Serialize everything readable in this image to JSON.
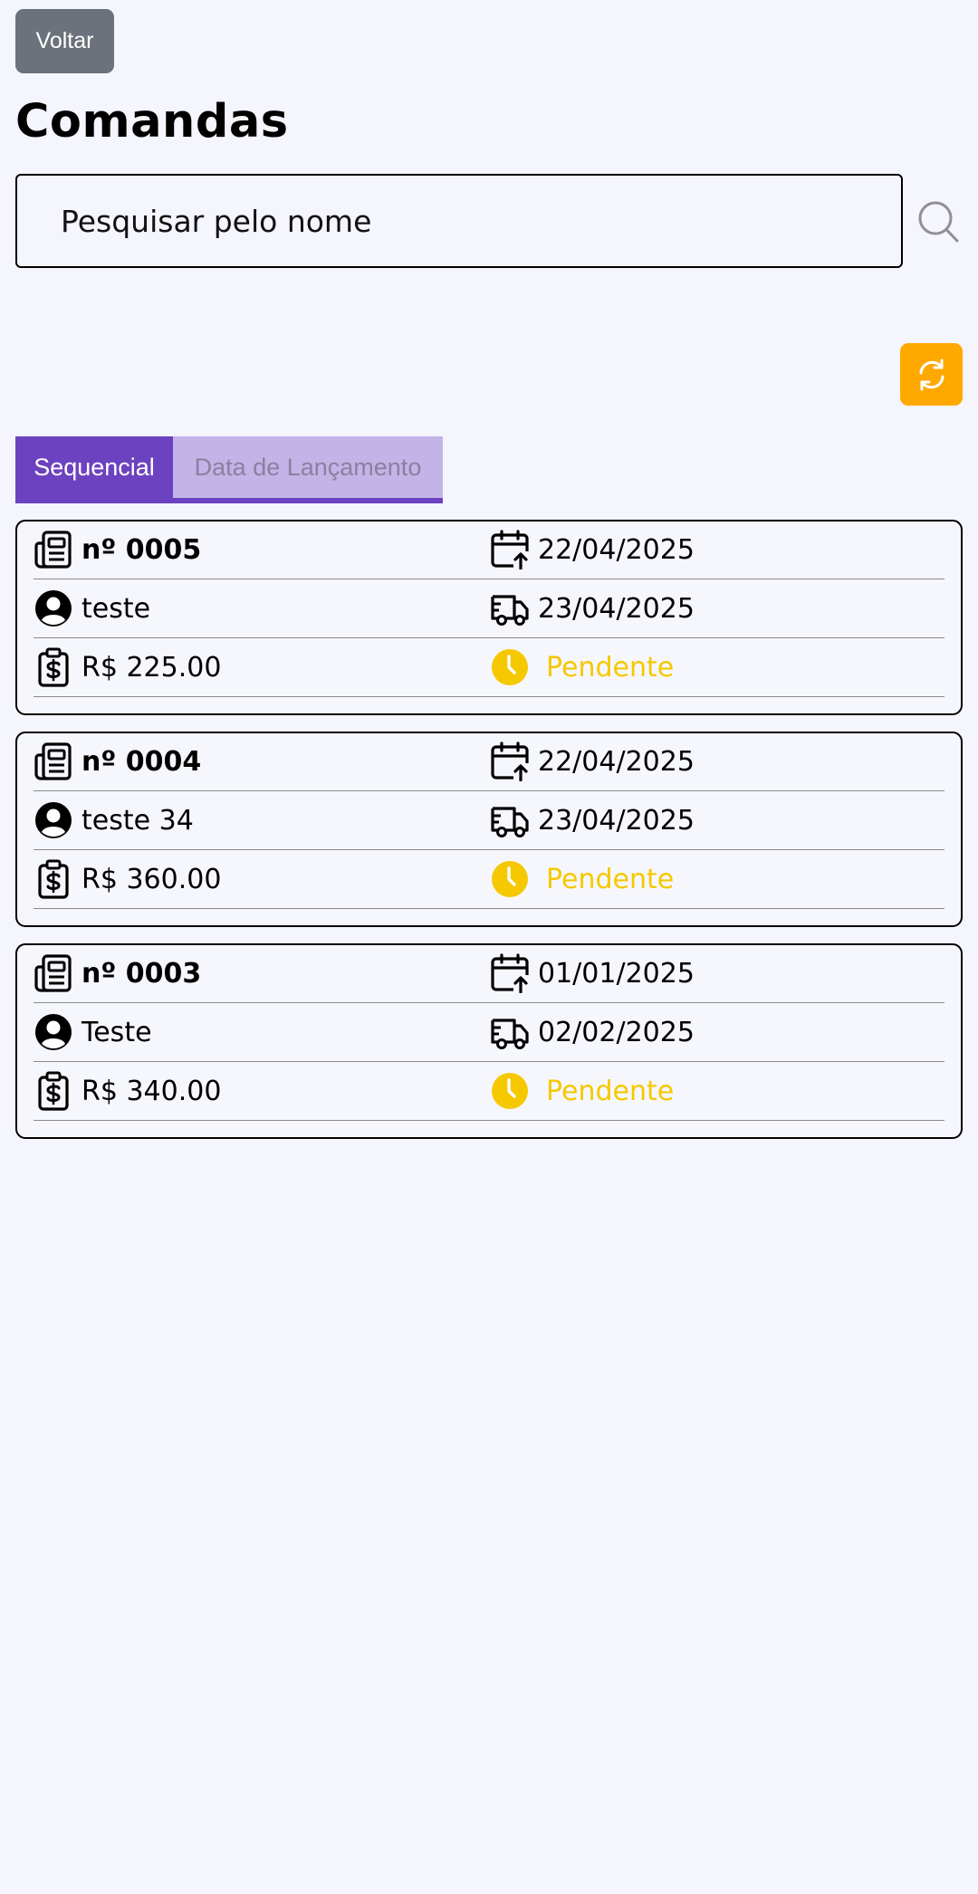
{
  "header": {
    "back_label": "Voltar",
    "title": "Comandas"
  },
  "search": {
    "placeholder": "Pesquisar pelo nome",
    "value": ""
  },
  "tabs": [
    {
      "label": "Sequencial",
      "active": true
    },
    {
      "label": "Data de Lançamento",
      "active": false
    }
  ],
  "colors": {
    "accent": "#6d42c0",
    "refresh": "#ffa800",
    "pending": "#f6c800",
    "back_button": "#6c727b"
  },
  "icons": {
    "order": "newspaper-icon",
    "customer": "user-circle-icon",
    "total": "clipboard-dollar-icon",
    "launch_date": "calendar-up-icon",
    "delivery_date": "truck-icon",
    "status": "clock-icon",
    "search": "search-icon",
    "refresh": "refresh-icon"
  },
  "orders": [
    {
      "number": "nº 0005",
      "customer": "teste",
      "total": "R$ 225.00",
      "launch_date": "22/04/2025",
      "delivery_date": "23/04/2025",
      "status": "Pendente"
    },
    {
      "number": "nº 0004",
      "customer": "teste 34",
      "total": "R$ 360.00",
      "launch_date": "22/04/2025",
      "delivery_date": "23/04/2025",
      "status": "Pendente"
    },
    {
      "number": "nº 0003",
      "customer": "Teste",
      "total": "R$ 340.00",
      "launch_date": "01/01/2025",
      "delivery_date": "02/02/2025",
      "status": "Pendente"
    }
  ]
}
